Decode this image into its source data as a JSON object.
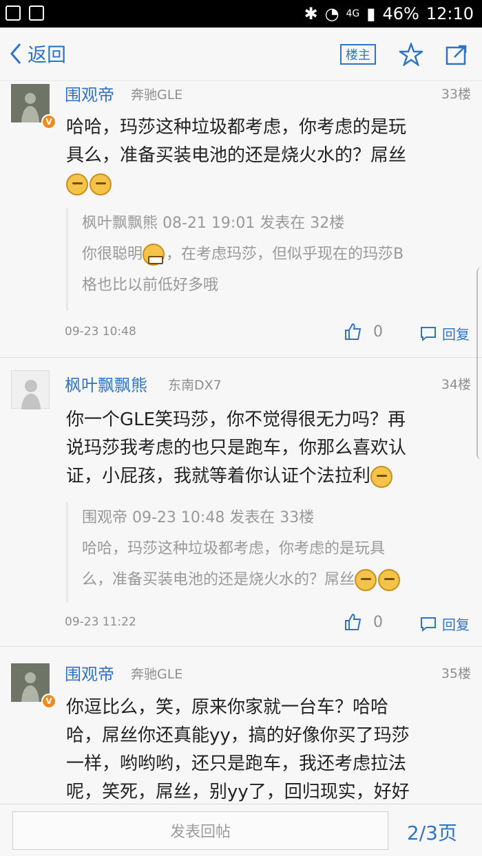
{
  "status_bar": {
    "network": "4G",
    "battery": "46%",
    "time": "12:10"
  },
  "nav": {
    "back_label": "返回",
    "op_label": "楼主"
  },
  "posts": [
    {
      "user": "围观帝",
      "car": "奔驰GLE",
      "floor": "33楼",
      "text_lines": [
        "哈哈，玛莎这种垃圾都考虑，你考虑的是玩",
        "具么，准备买装电池的还是烧火水的？屌丝"
      ],
      "quote_header": "枫叶飘飘熊 08-21 19:01 发表在 32楼",
      "quote_line1": "你很聪明",
      "quote_line1b": "，在考虑玛莎，但似乎现在的玛莎B",
      "quote_line2": "格也比以前低好多哦",
      "date": "09-23 10:48",
      "likes": "0",
      "reply": "回复"
    },
    {
      "user": "枫叶飘飘熊",
      "car": "东南DX7",
      "floor": "34楼",
      "text_lines": [
        "你一个GLE笑玛莎，你不觉得很无力吗？再",
        "说玛莎我考虑的也只是跑车，你那么喜欢认",
        "证，小屁孩，我就等着你认证个法拉利"
      ],
      "quote_header": "围观帝 09-23 10:48 发表在 33楼",
      "quote_line1": "哈哈，玛莎这种垃圾都考虑，你考虑的是玩具",
      "quote_line2": "么，准备买装电池的还是烧火水的？屌丝",
      "date": "09-23 11:22",
      "likes": "0",
      "reply": "回复"
    },
    {
      "user": "围观帝",
      "car": "奔驰GLE",
      "floor": "35楼",
      "text_lines": [
        "你逗比么，笑，原来你家就一台车？哈哈",
        "哈，屌丝你还真能yy，搞的好像你买了玛莎",
        "一样，哟哟哟，还只是跑车，我还考虑拉法",
        "呢，笑死，屌丝，别yy了，回归现实，好好"
      ]
    }
  ],
  "bottom": {
    "input_placeholder": "发表回帖",
    "pagination": "2/3页"
  }
}
